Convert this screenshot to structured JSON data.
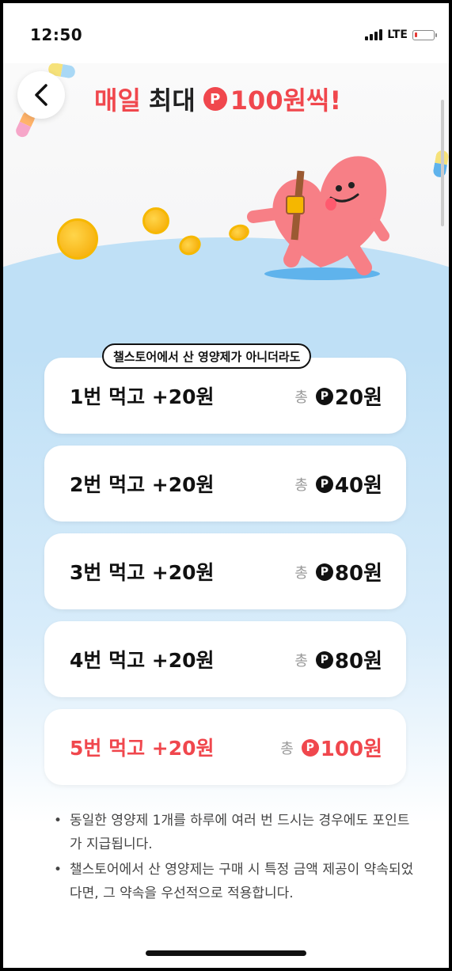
{
  "status_bar": {
    "time": "12:50",
    "network": "LTE"
  },
  "header": {
    "title_prefix_red": "매일",
    "title_middle": "최대",
    "point_symbol": "P",
    "title_amount": "100원씩!",
    "back_icon": "chevron-left-icon"
  },
  "notice": "챌스토어에서 산 영양제가 아니더라도",
  "rewards": [
    {
      "label": "1번 먹고 +20원",
      "total_word": "총",
      "point_symbol": "P",
      "total_amount": "20원",
      "highlight": false
    },
    {
      "label": "2번 먹고 +20원",
      "total_word": "총",
      "point_symbol": "P",
      "total_amount": "40원",
      "highlight": false
    },
    {
      "label": "3번 먹고 +20원",
      "total_word": "총",
      "point_symbol": "P",
      "total_amount": "80원",
      "highlight": false
    },
    {
      "label": "4번 먹고 +20원",
      "total_word": "총",
      "point_symbol": "P",
      "total_amount": "80원",
      "highlight": false
    },
    {
      "label": "5번 먹고 +20원",
      "total_word": "총",
      "point_symbol": "P",
      "total_amount": "100원",
      "highlight": true
    }
  ],
  "notes": [
    "동일한 영양제 1개를 하루에 여러 번 드시는 경우에도 포인트가 지급됩니다.",
    "챌스토어에서 산 영양제는 구매 시 특정 금액 제공이 약속되었다면, 그 약속을 우선적으로 적용합니다."
  ],
  "colors": {
    "accent": "#f0474d",
    "sky": "#bfe0f6"
  }
}
